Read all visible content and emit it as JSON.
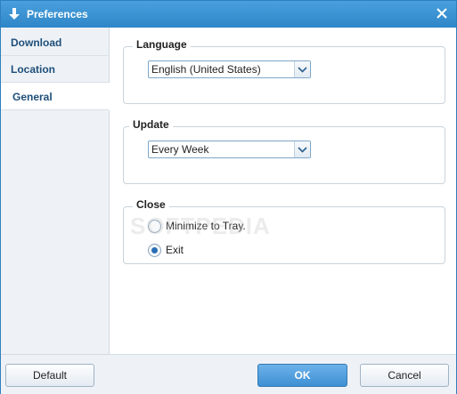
{
  "window": {
    "title": "Preferences"
  },
  "sidebar": {
    "items": [
      {
        "label": "Download",
        "active": false
      },
      {
        "label": "Location",
        "active": false
      },
      {
        "label": "General",
        "active": true
      }
    ]
  },
  "language": {
    "legend": "Language",
    "selected": "English (United States)"
  },
  "update": {
    "legend": "Update",
    "selected": "Every Week"
  },
  "close": {
    "legend": "Close",
    "options": [
      {
        "label": "Minimize to Tray.",
        "checked": false
      },
      {
        "label": "Exit",
        "checked": true
      }
    ]
  },
  "footer": {
    "default_label": "Default",
    "ok_label": "OK",
    "cancel_label": "Cancel"
  },
  "watermark": "SOFTPEDIA",
  "colors": {
    "titlebar": "#3592d2",
    "accent": "#3e8fd3",
    "sidebar_text": "#1f4f7a"
  }
}
